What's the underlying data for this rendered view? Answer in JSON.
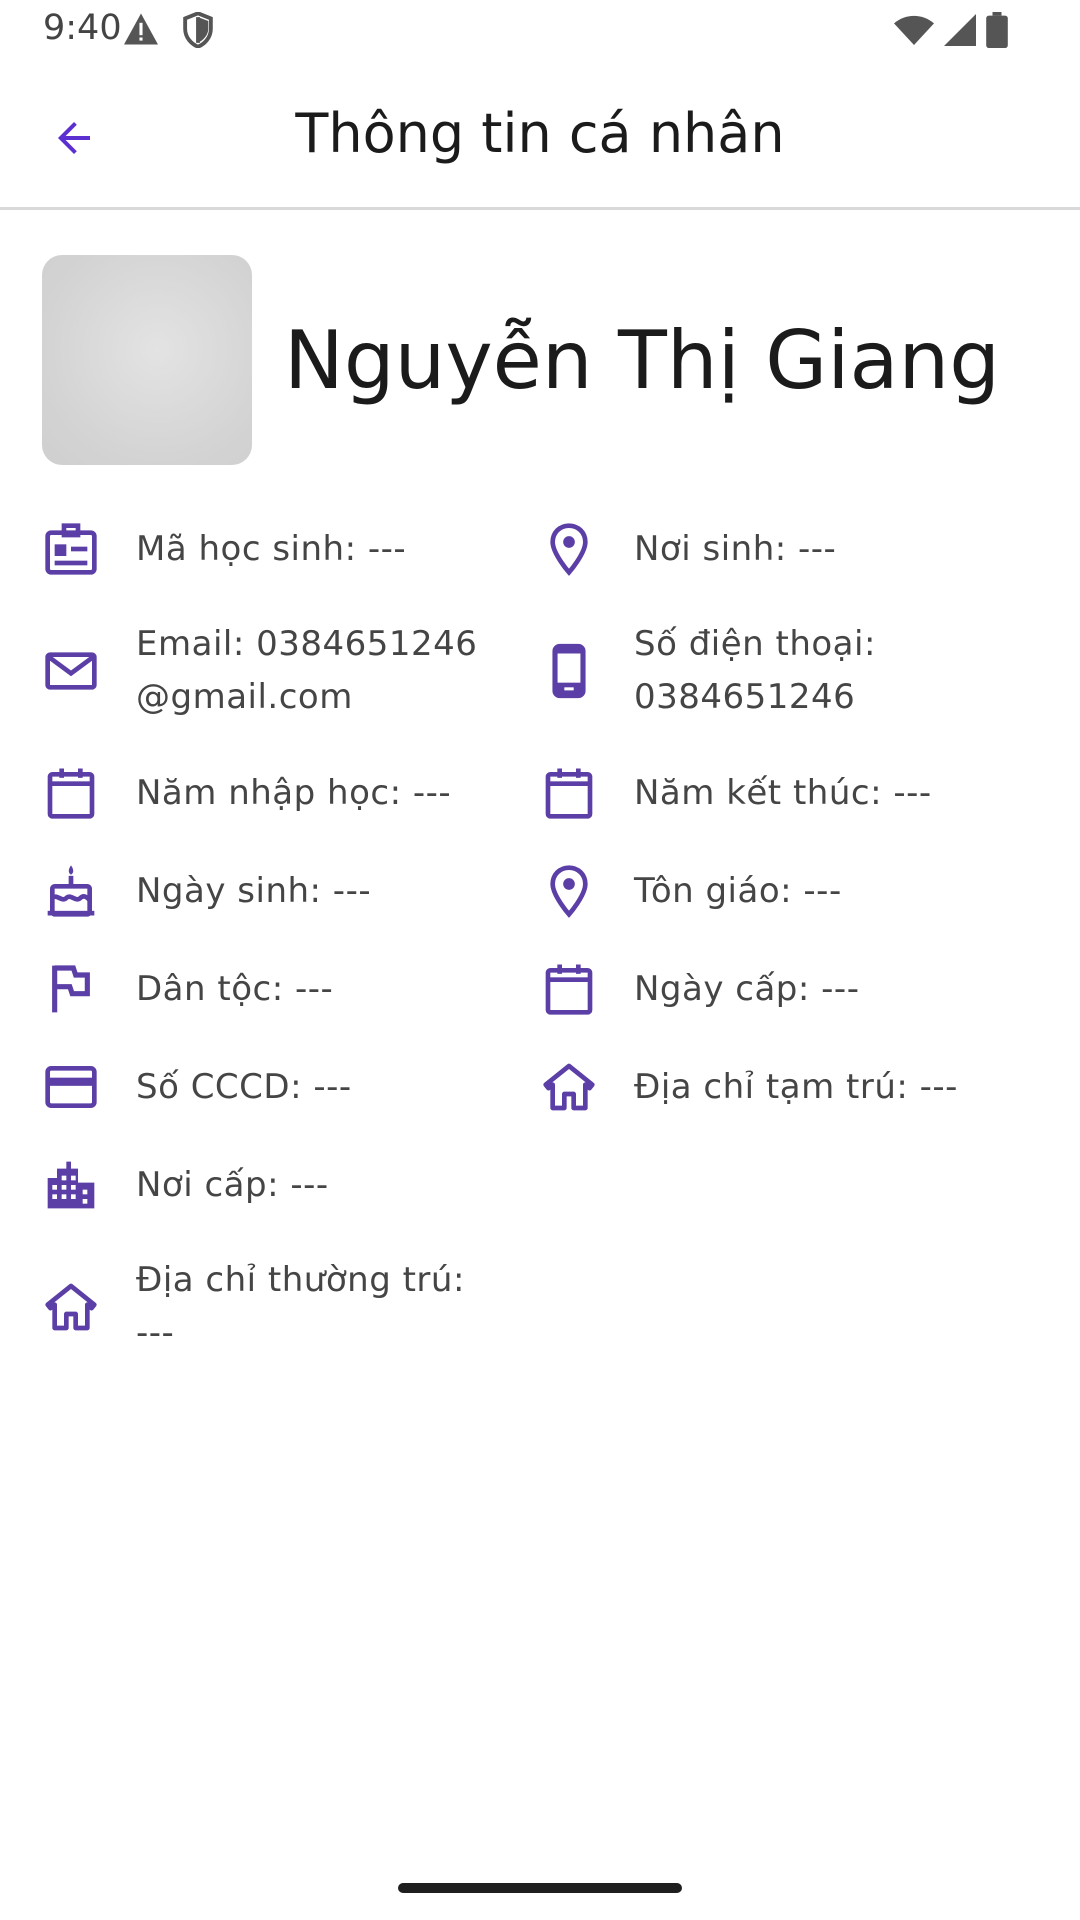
{
  "status_bar": {
    "time": "9:40",
    "left_icons": [
      "warning-icon",
      "shield-icon"
    ],
    "right_icons": [
      "wifi-icon",
      "signal-icon",
      "battery-icon"
    ]
  },
  "app_bar": {
    "title": "Thông tin cá nhân",
    "back_icon": "arrow-back-icon"
  },
  "profile": {
    "name": "Nguyễn Thị Giang"
  },
  "colors": {
    "accent": "#5b3fa6",
    "back_arrow": "#5b2fd0",
    "divider": "#d9d9d9",
    "avatar_bg": "#d6d6d6"
  },
  "info": {
    "student_id": {
      "line1": "Mã học sinh: ---",
      "icon": "id-badge-icon"
    },
    "birthplace": {
      "line1": "Nơi sinh: ---",
      "icon": "location-pin-icon"
    },
    "email": {
      "line1": "Email: 0384651246",
      "line2": "@gmail.com",
      "icon": "mail-icon"
    },
    "phone": {
      "line1": "Số điện thoại:",
      "line2": "0384651246",
      "icon": "phone-icon"
    },
    "enroll_year": {
      "line1": "Năm nhập học: ---",
      "icon": "calendar-icon"
    },
    "end_year": {
      "line1": "Năm kết thúc: ---",
      "icon": "calendar-icon"
    },
    "birthday": {
      "line1": "Ngày sinh: ---",
      "icon": "cake-icon"
    },
    "religion": {
      "line1": "Tôn giáo: ---",
      "icon": "location-pin-icon"
    },
    "ethnicity": {
      "line1": "Dân tộc: ---",
      "icon": "flag-icon"
    },
    "issue_date": {
      "line1": "Ngày cấp: ---",
      "icon": "calendar-icon"
    },
    "cccd": {
      "line1": "Số CCCD: ---",
      "icon": "credit-card-icon"
    },
    "temp_address": {
      "line1": "Địa chỉ tạm trú: ---",
      "icon": "home-icon"
    },
    "issue_place": {
      "line1": "Nơi cấp: ---",
      "icon": "buildings-icon"
    },
    "perm_address": {
      "line1": "Địa chỉ thường trú:",
      "line2": "---",
      "icon": "home-icon"
    }
  }
}
